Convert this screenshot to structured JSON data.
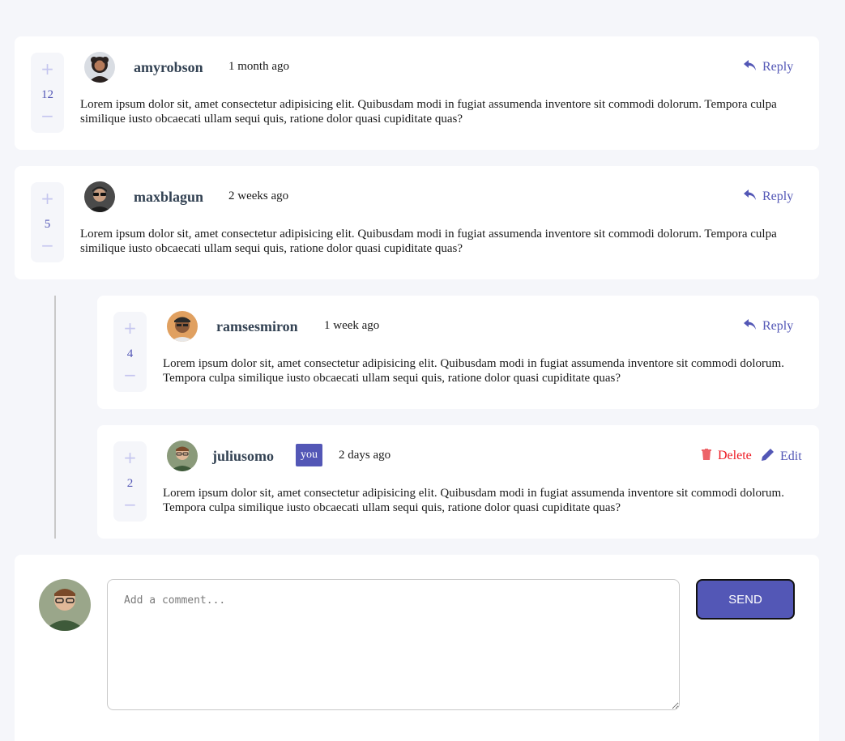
{
  "comments": [
    {
      "username": "amyrobson",
      "time": "1 month ago",
      "score": "12",
      "plus": "+",
      "minus": "−",
      "action": "Reply",
      "content": "Lorem ipsum dolor sit, amet consectetur adipisicing elit. Quibusdam modi in fugiat assumenda inventore sit commodi dolorum. Tempora culpa similique iusto obcaecati ullam sequi quis, ratione dolor quasi cupiditate quas?"
    },
    {
      "username": "maxblagun",
      "time": "2 weeks ago",
      "score": "5",
      "plus": "+",
      "minus": "−",
      "action": "Reply",
      "content": "Lorem ipsum dolor sit, amet consectetur adipisicing elit. Quibusdam modi in fugiat assumenda inventore sit commodi dolorum. Tempora culpa similique iusto obcaecati ullam sequi quis, ratione dolor quasi cupiditate quas?"
    }
  ],
  "replies": [
    {
      "username": "ramsesmiron",
      "time": "1 week ago",
      "score": "4",
      "plus": "+",
      "minus": "−",
      "action": "Reply",
      "content": "Lorem ipsum dolor sit, amet consectetur adipisicing elit. Quibusdam modi in fugiat assumenda inventore sit commodi dolorum. Tempora culpa similique iusto obcaecati ullam sequi quis, ratione dolor quasi cupiditate quas?"
    },
    {
      "username": "juliusomo",
      "you_badge": "you",
      "time": "2 days ago",
      "score": "2",
      "plus": "+",
      "minus": "−",
      "delete_label": "Delete",
      "edit_label": "Edit",
      "content": "Lorem ipsum dolor sit, amet consectetur adipisicing elit. Quibusdam modi in fugiat assumenda inventore sit commodi dolorum. Tempora culpa similique iusto obcaecati ullam sequi quis, ratione dolor quasi cupiditate quas?"
    }
  ],
  "composer": {
    "placeholder": "Add a comment...",
    "send_label": "SEND"
  },
  "icons": {
    "reply": "reply-arrow-icon",
    "delete": "trash-icon",
    "edit": "pencil-icon"
  },
  "colors": {
    "primary": "#5357b6",
    "vote_light": "#c5c6ef",
    "danger": "#ed1b24",
    "background": "#f5f6fa",
    "username": "#334253"
  }
}
